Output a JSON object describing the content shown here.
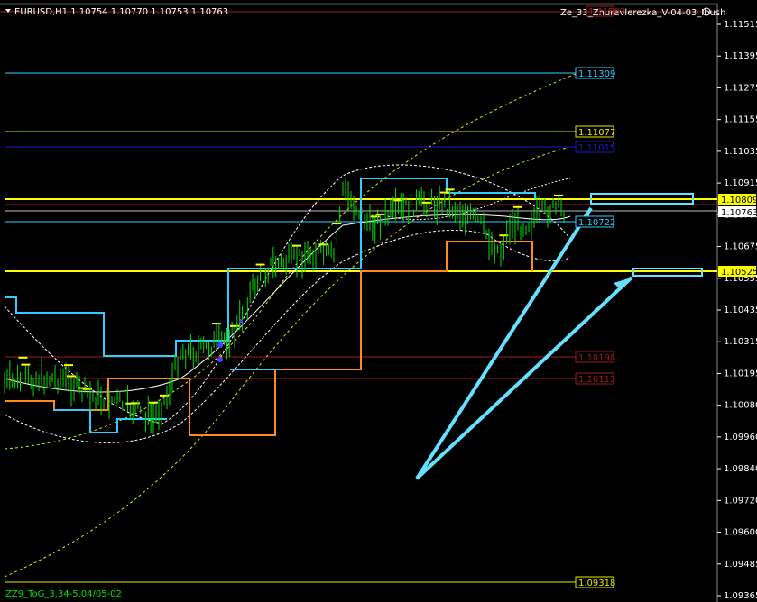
{
  "header": {
    "symbol_line": "EURUSD,H1  1.10754 1.10770 1.10753 1.10763",
    "indicator_label": "Ze_33_Zhuravlerezka_V-04-03_Ibush",
    "indicator_icon": "smiley-icon",
    "bottom_left_label": "ZZ9_ToG_3.34-5.04/05-02"
  },
  "colors": {
    "background": "#000000",
    "axis_text": "#ffffff",
    "yellow": "#ffff00",
    "cyan": "#33ccff",
    "orange": "#ff8c1a",
    "darkred": "#a11a1a",
    "blue": "#1a1acc",
    "candle_up": "#00e000",
    "arrow": "#66e0ff"
  },
  "chart_data": {
    "type": "candlestick",
    "symbol": "EURUSD",
    "timeframe": "H1",
    "ylim": [
      1.0925,
      1.12
    ],
    "y_ticks": [
      "1.11515",
      "1.11395",
      "1.11275",
      "1.11155",
      "1.11035",
      "1.10915",
      "1.10795",
      "1.10675",
      "1.10555",
      "1.10435",
      "1.10315",
      "1.10195",
      "1.10080",
      "1.09960",
      "1.09840",
      "1.09720",
      "1.09600",
      "1.09485",
      "1.09365"
    ],
    "price_labels": [
      {
        "value": "1.11309",
        "style": "cyan"
      },
      {
        "value": "1.11077",
        "style": "yellow"
      },
      {
        "value": "1.11015",
        "style": "blue"
      },
      {
        "value": "1.10809",
        "style": "yellow-fill"
      },
      {
        "value": "1.10763",
        "style": "white-fill"
      },
      {
        "value": "1.10722",
        "style": "cyan"
      },
      {
        "value": "1.10525",
        "style": "yellow-fill"
      },
      {
        "value": "1.10198",
        "style": "darkred"
      },
      {
        "value": "1.10113",
        "style": "darkred"
      },
      {
        "value": "1.09318",
        "style": "yellow"
      }
    ],
    "bid_top_label": "1.11593"
  }
}
